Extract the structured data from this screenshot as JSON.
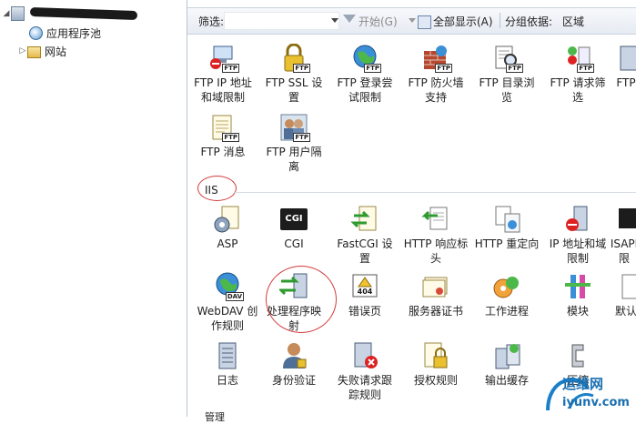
{
  "tree": {
    "root_label": "",
    "app_pools": "应用程序池",
    "sites": "网站"
  },
  "filter": {
    "label": "筛选:",
    "start": "开始(G)",
    "show_all": "全部显示(A)",
    "group_by_label": "分组依据:",
    "group_by_value": "区域"
  },
  "ftp_items": [
    {
      "l1": "FTP IP 地址",
      "l2": "和域限制"
    },
    {
      "l1": "FTP SSL 设",
      "l2": "置"
    },
    {
      "l1": "FTP 登录尝",
      "l2": "试限制"
    },
    {
      "l1": "FTP 防火墙",
      "l2": "支持"
    },
    {
      "l1": "FTP 目录浏",
      "l2": "览"
    },
    {
      "l1": "FTP 请求筛",
      "l2": "选"
    },
    {
      "l1": "FTP",
      "l2": ""
    },
    {
      "l1": "FTP 消息",
      "l2": ""
    },
    {
      "l1": "FTP 用户隔",
      "l2": "离"
    }
  ],
  "iis_header": "IIS",
  "iis_items": [
    {
      "l1": "ASP",
      "l2": ""
    },
    {
      "l1": "CGI",
      "l2": ""
    },
    {
      "l1": "FastCGI 设",
      "l2": "置"
    },
    {
      "l1": "HTTP 响应标",
      "l2": "头"
    },
    {
      "l1": "HTTP 重定向",
      "l2": ""
    },
    {
      "l1": "IP 地址和域",
      "l2": "限制"
    },
    {
      "l1": "ISAPI",
      "l2": "限"
    },
    {
      "l1": "WebDAV 创",
      "l2": "作规则"
    },
    {
      "l1": "处理程序映",
      "l2": "射"
    },
    {
      "l1": "错误页",
      "l2": ""
    },
    {
      "l1": "服务器证书",
      "l2": ""
    },
    {
      "l1": "工作进程",
      "l2": ""
    },
    {
      "l1": "模块",
      "l2": ""
    },
    {
      "l1": "默认",
      "l2": ""
    },
    {
      "l1": "日志",
      "l2": ""
    },
    {
      "l1": "身份验证",
      "l2": ""
    },
    {
      "l1": "失败请求跟",
      "l2": "踪规则"
    },
    {
      "l1": "授权规则",
      "l2": ""
    },
    {
      "l1": "输出缓存",
      "l2": ""
    },
    {
      "l1": "压缩",
      "l2": ""
    }
  ],
  "ftp_badge": "FTP",
  "cgi_badge": "CGI",
  "error_badge": "404",
  "dav_badge": "DAV",
  "bottom_section": "管理",
  "watermark": {
    "brand": "运维网",
    "url": "iyunv.com"
  }
}
